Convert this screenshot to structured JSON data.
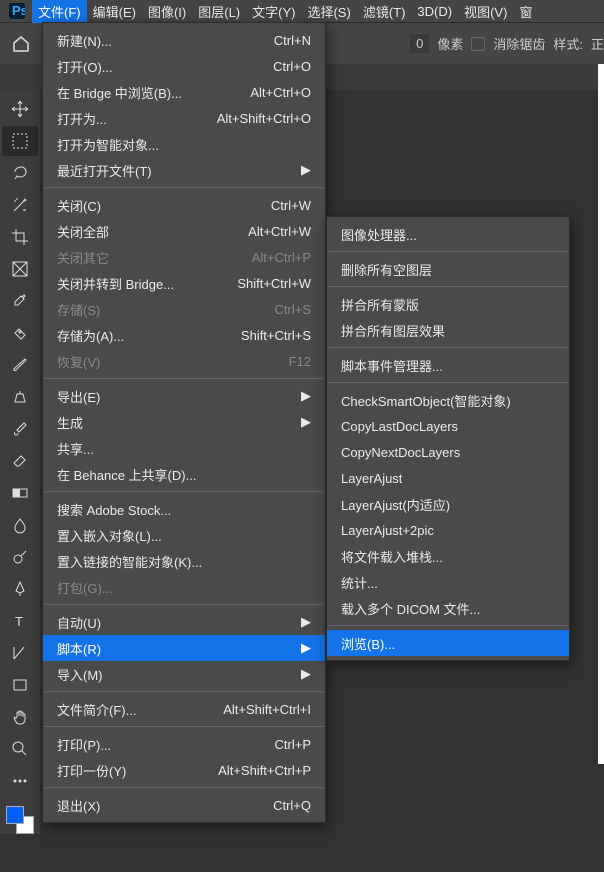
{
  "menubar": {
    "items": [
      {
        "label": "文件(F)",
        "active": true
      },
      {
        "label": "编辑(E)"
      },
      {
        "label": "图像(I)"
      },
      {
        "label": "图层(L)"
      },
      {
        "label": "文字(Y)"
      },
      {
        "label": "选择(S)"
      },
      {
        "label": "滤镜(T)"
      },
      {
        "label": "3D(D)"
      },
      {
        "label": "视图(V)"
      },
      {
        "label": "窗"
      }
    ]
  },
  "options_bar": {
    "px_value": "0",
    "px_unit": "像素",
    "antialias_label": "消除锯齿",
    "style_label": "样式:",
    "style_value": "正"
  },
  "file_menu": {
    "groups": [
      [
        {
          "label": "新建(N)...",
          "shortcut": "Ctrl+N"
        },
        {
          "label": "打开(O)...",
          "shortcut": "Ctrl+O"
        },
        {
          "label": "在 Bridge 中浏览(B)...",
          "shortcut": "Alt+Ctrl+O"
        },
        {
          "label": "打开为...",
          "shortcut": "Alt+Shift+Ctrl+O"
        },
        {
          "label": "打开为智能对象..."
        },
        {
          "label": "最近打开文件(T)",
          "submenu": true
        }
      ],
      [
        {
          "label": "关闭(C)",
          "shortcut": "Ctrl+W"
        },
        {
          "label": "关闭全部",
          "shortcut": "Alt+Ctrl+W"
        },
        {
          "label": "关闭其它",
          "shortcut": "Alt+Ctrl+P",
          "disabled": true
        },
        {
          "label": "关闭并转到 Bridge...",
          "shortcut": "Shift+Ctrl+W"
        },
        {
          "label": "存储(S)",
          "shortcut": "Ctrl+S",
          "disabled": true
        },
        {
          "label": "存储为(A)...",
          "shortcut": "Shift+Ctrl+S"
        },
        {
          "label": "恢复(V)",
          "shortcut": "F12",
          "disabled": true
        }
      ],
      [
        {
          "label": "导出(E)",
          "submenu": true
        },
        {
          "label": "生成",
          "submenu": true
        },
        {
          "label": "共享..."
        },
        {
          "label": "在 Behance 上共享(D)..."
        }
      ],
      [
        {
          "label": "搜索 Adobe Stock..."
        },
        {
          "label": "置入嵌入对象(L)..."
        },
        {
          "label": "置入链接的智能对象(K)..."
        },
        {
          "label": "打包(G)...",
          "disabled": true
        }
      ],
      [
        {
          "label": "自动(U)",
          "submenu": true
        },
        {
          "label": "脚本(R)",
          "submenu": true,
          "hover": true
        },
        {
          "label": "导入(M)",
          "submenu": true
        }
      ],
      [
        {
          "label": "文件简介(F)...",
          "shortcut": "Alt+Shift+Ctrl+I"
        }
      ],
      [
        {
          "label": "打印(P)...",
          "shortcut": "Ctrl+P"
        },
        {
          "label": "打印一份(Y)",
          "shortcut": "Alt+Shift+Ctrl+P"
        }
      ],
      [
        {
          "label": "退出(X)",
          "shortcut": "Ctrl+Q"
        }
      ]
    ]
  },
  "script_submenu": {
    "groups": [
      [
        {
          "label": "图像处理器..."
        }
      ],
      [
        {
          "label": "删除所有空图层"
        }
      ],
      [
        {
          "label": "拼合所有蒙版"
        },
        {
          "label": "拼合所有图层效果"
        }
      ],
      [
        {
          "label": "脚本事件管理器..."
        }
      ],
      [
        {
          "label": "CheckSmartObject(智能对象)"
        },
        {
          "label": "CopyLastDocLayers"
        },
        {
          "label": "CopyNextDocLayers"
        },
        {
          "label": "LayerAjust"
        },
        {
          "label": "LayerAjust(内适应)"
        },
        {
          "label": "LayerAjust+2pic"
        },
        {
          "label": "将文件载入堆栈..."
        },
        {
          "label": "统计..."
        },
        {
          "label": "载入多个 DICOM 文件..."
        }
      ],
      [
        {
          "label": "浏览(B)...",
          "hover": true
        }
      ]
    ]
  },
  "tools": [
    "move",
    "marquee",
    "lasso",
    "wand",
    "crop",
    "frame",
    "eyedropper",
    "heal",
    "brush",
    "clone",
    "history",
    "eraser",
    "gradient",
    "blur",
    "dodge",
    "pen",
    "type",
    "path",
    "rect",
    "hand",
    "zoom",
    "more"
  ]
}
